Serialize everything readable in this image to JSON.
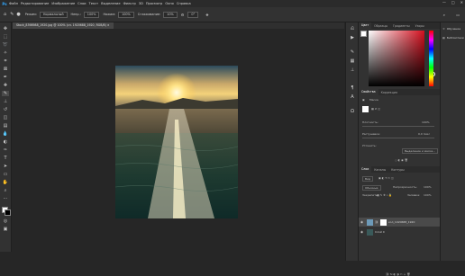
{
  "menubar": {
    "logo": "Ps",
    "items": [
      "Файл",
      "Редактирование",
      "Изображение",
      "Слои",
      "Текст",
      "Выделение",
      "Фильтр",
      "3D",
      "Просмотр",
      "Окно",
      "Справка"
    ]
  },
  "optbar": {
    "mode_label": "Режим:",
    "mode_value": "Нормальный",
    "opacity_label": "Непр.:",
    "opacity_value": "100%",
    "pressure_label": "Нажим:",
    "pressure_value": "100%",
    "smooth_label": "Сглаживание:",
    "smooth_value": "10%",
    "angle_value": "0°"
  },
  "document": {
    "tab_title": "Stock_8398988_1920.jpg @ 100% (сл. 1920688_1920, RGB/8) ×"
  },
  "colors": {
    "accent": "#31a8ff",
    "picked": "#d5101f"
  },
  "panels": {
    "color_tabs": [
      "Цвет",
      "Образцы",
      "Градиенты",
      "Узоры"
    ],
    "properties_tabs": [
      "Свойства",
      "Коррекция"
    ],
    "properties_title": "Маска",
    "density_label": "Плотность:",
    "density_value": "100%",
    "feather_label": "Растушевка:",
    "feather_value": "0,0 пикс",
    "refine_label": "Уточнить:",
    "refine_button": "Выделение и маска...",
    "layers_tabs": [
      "Слои",
      "Каналы",
      "Контуры"
    ],
    "kind_label": "Вид",
    "blend_mode": "Обычные",
    "opacity_label": "Непрозрачность:",
    "opacity_value": "100%",
    "lock_label": "Закрепить:",
    "fill_label": "Заливка:",
    "fill_value": "100%",
    "layers": [
      {
        "name": "кол_1920688_1920",
        "active": true
      },
      {
        "name": "Слой 0",
        "active": false
      }
    ]
  },
  "farright": {
    "items": [
      {
        "icon": "learn-icon",
        "label": "Обучение"
      },
      {
        "icon": "library-icon",
        "label": "Библиотеки"
      }
    ]
  }
}
